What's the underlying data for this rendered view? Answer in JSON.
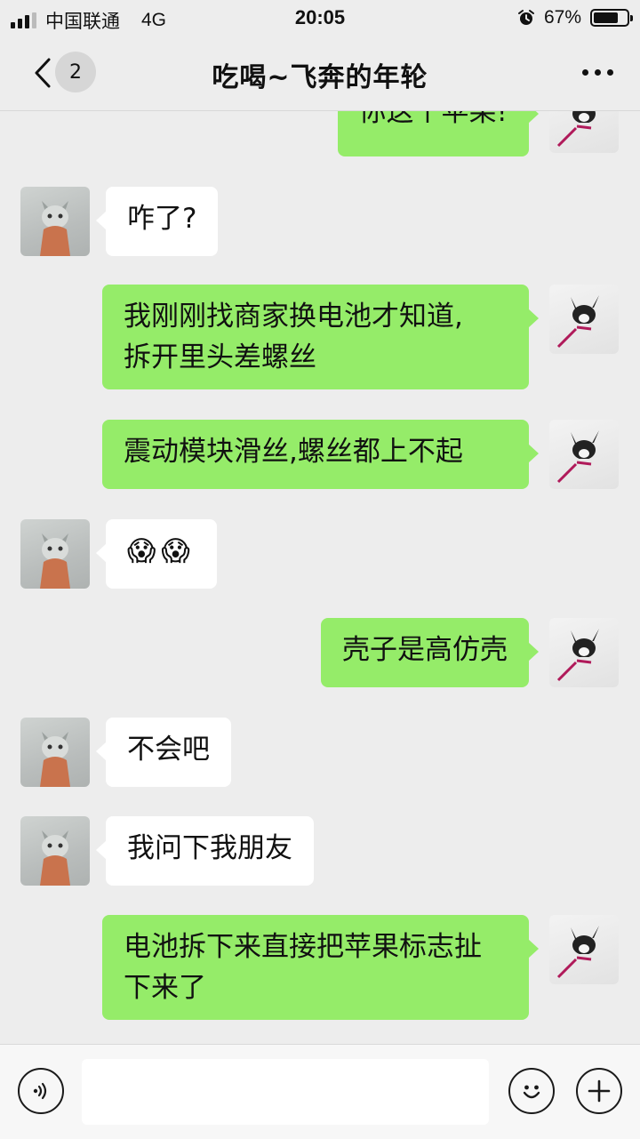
{
  "status_bar": {
    "carrier": "中国联通",
    "network": "4G",
    "time": "20:05",
    "battery": "67%",
    "battery_level": 0.67
  },
  "header": {
    "unread_count": "2",
    "title": "吃喝~飞奔的年轮"
  },
  "messages": [
    {
      "from": "me",
      "text": "你这个苹果!"
    },
    {
      "from": "other",
      "text": "咋了?"
    },
    {
      "from": "me",
      "text": "我刚刚找商家换电池才知道,\n拆开里头差螺丝"
    },
    {
      "from": "me",
      "text": "震动模块滑丝,螺丝都上不起"
    },
    {
      "from": "other",
      "text": "😱😱"
    },
    {
      "from": "me",
      "text": "壳子是高仿壳"
    },
    {
      "from": "other",
      "text": "不会吧"
    },
    {
      "from": "other",
      "text": "我问下我朋友"
    },
    {
      "from": "me",
      "text": "电池拆下来直接把苹果标志扯\n下来了"
    }
  ],
  "input": {
    "value": ""
  },
  "colors": {
    "background": "#ededed",
    "outgoing_bubble": "#95ec69",
    "incoming_bubble": "#ffffff"
  }
}
